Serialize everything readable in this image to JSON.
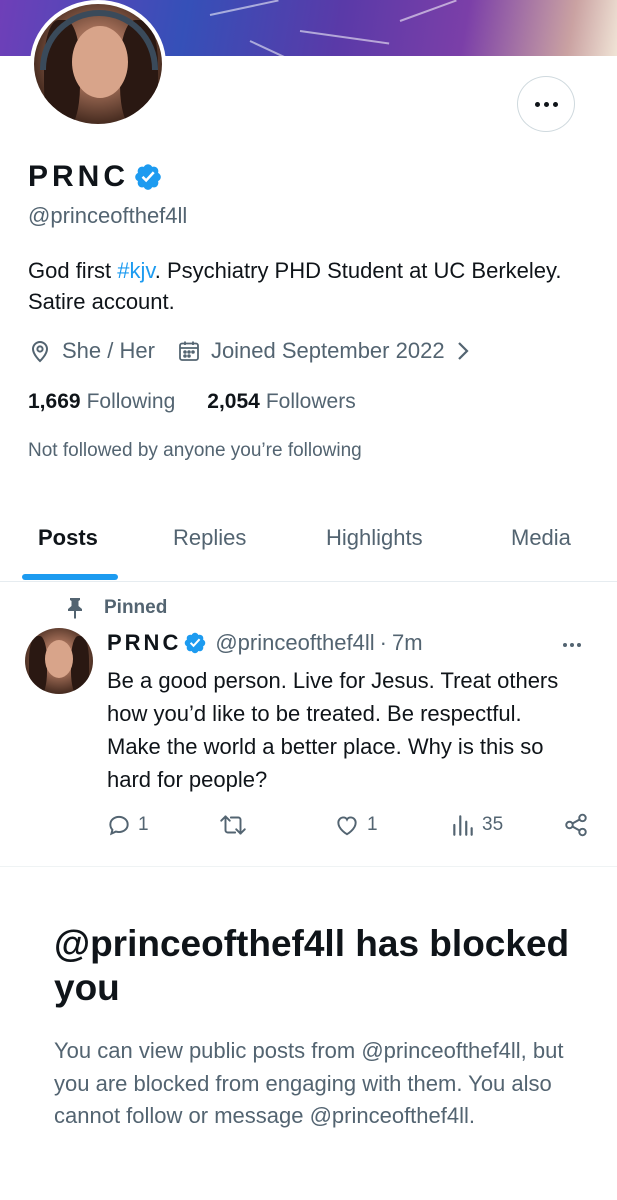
{
  "profile": {
    "display_name": "PRNC",
    "handle": "@princeofthef4ll",
    "bio_prefix": "God first ",
    "bio_hashtag": "#kjv",
    "bio_suffix": ". Psychiatry PHD Student at UC Berkeley. Satire account.",
    "pronouns": "She / Her",
    "joined": "Joined September 2022",
    "following_count": "1,669",
    "following_label": "Following",
    "followers_count": "2,054",
    "followers_label": "Followers",
    "not_followed_text": "Not followed by anyone you’re following"
  },
  "tabs": [
    {
      "label": "Posts",
      "active": true
    },
    {
      "label": "Replies",
      "active": false
    },
    {
      "label": "Highlights",
      "active": false
    },
    {
      "label": "Media",
      "active": false
    }
  ],
  "pinned_post": {
    "pinned_label": "Pinned",
    "author_name": "PRNC",
    "author_handle": "@princeofthef4ll",
    "separator": "·",
    "time": "7m",
    "text": "Be a good person. Live for Jesus. Treat others how you’d like to be treated. Be respectful. Make the world a better place. Why is this so hard for people?",
    "reply_count": "1",
    "like_count": "1",
    "view_count": "35"
  },
  "blocked_notice": {
    "title": "@princeofthef4ll has blocked you",
    "description": "You can view public posts from @princeofthef4ll, but you are blocked from engaging with them. You also cannot follow or message @princeofthef4ll."
  },
  "colors": {
    "accent": "#1d9bf0",
    "text_primary": "#0f1419",
    "text_secondary": "#536471"
  },
  "icons": {
    "more": "more-horizontal-icon",
    "verified": "verified-badge-icon",
    "location": "location-pin-icon",
    "calendar": "calendar-icon",
    "chevron": "chevron-right-icon",
    "pin": "pin-icon",
    "reply": "reply-icon",
    "repost": "repost-icon",
    "like": "heart-icon",
    "views": "views-icon",
    "share": "share-icon"
  }
}
